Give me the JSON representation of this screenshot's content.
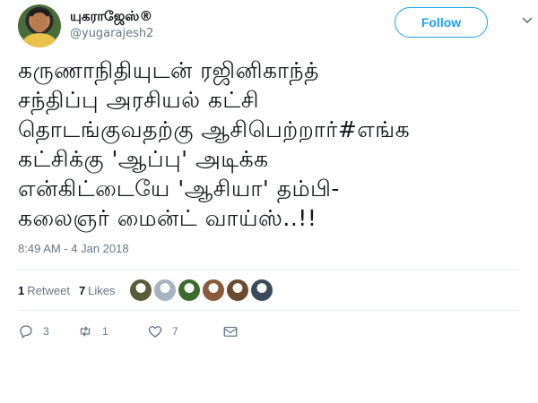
{
  "author": {
    "name": "யுகராஜேஸ்®",
    "handle": "@yugarajesh2"
  },
  "follow_label": "Follow",
  "tweet_text": "கருணாநிதியுடன் ரஜினிகாந்த்\nசந்திப்பு அரசியல் கட்சி\nதொடங்குவதற்கு ஆசிபெற்றார்#எங்க\nகட்சிக்கு 'ஆப்பு' அடிக்க\nஎன்கிட்டையே 'ஆசியா' தம்பி-\nகலைஞர் மைன்ட் வாய்ஸ்..!!",
  "timestamp": "8:49 AM - 4 Jan 2018",
  "stats": {
    "retweets_count": "1",
    "retweets_label": "Retweet",
    "likes_count": "7",
    "likes_label": "Likes"
  },
  "likers": [
    {
      "icon": "liker-avatar",
      "color": "#5a5a3c"
    },
    {
      "icon": "default-avatar",
      "color": "#a7b4bf"
    },
    {
      "icon": "liker-avatar",
      "color": "#3c6b2e"
    },
    {
      "icon": "liker-avatar",
      "color": "#8a5a3a"
    },
    {
      "icon": "liker-avatar",
      "color": "#6b4a32"
    },
    {
      "icon": "liker-avatar",
      "color": "#3a4a5a"
    }
  ],
  "actions": {
    "replies": "3",
    "retweets": "1",
    "likes": "7"
  },
  "colors": {
    "accent": "#1da1f2",
    "muted": "#657786"
  }
}
